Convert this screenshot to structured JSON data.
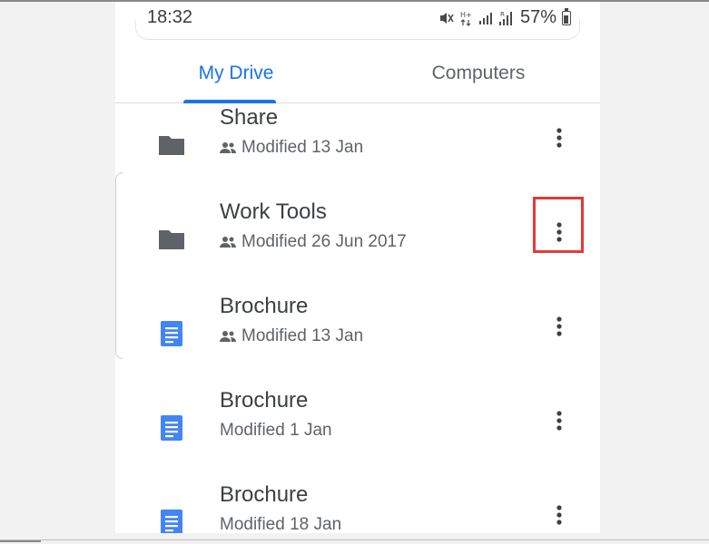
{
  "status_bar": {
    "time": "18:32",
    "battery": "57%",
    "icons": [
      "mute-icon",
      "data-hplus-icon",
      "signal-icon",
      "signal-roaming-icon",
      "battery-icon"
    ]
  },
  "tabs": [
    {
      "label": "My Drive",
      "active": true
    },
    {
      "label": "Computers",
      "active": false
    }
  ],
  "files": [
    {
      "name": "Share",
      "modified": "Modified 13 Jan",
      "type": "folder",
      "shared": true
    },
    {
      "name": "Work Tools",
      "modified": "Modified 26 Jun 2017",
      "type": "folder",
      "shared": true,
      "highlighted": true
    },
    {
      "name": "Brochure",
      "modified": "Modified 13 Jan",
      "type": "doc",
      "shared": true
    },
    {
      "name": "Brochure",
      "modified": "Modified 1 Jan",
      "type": "doc",
      "shared": false
    },
    {
      "name": "Brochure",
      "modified": "Modified 18 Jan",
      "type": "doc",
      "shared": false
    }
  ],
  "colors": {
    "accent": "#1a73e8",
    "folder_grey": "#5f6368",
    "doc_blue": "#4285f4",
    "highlight_red": "#e53935"
  }
}
